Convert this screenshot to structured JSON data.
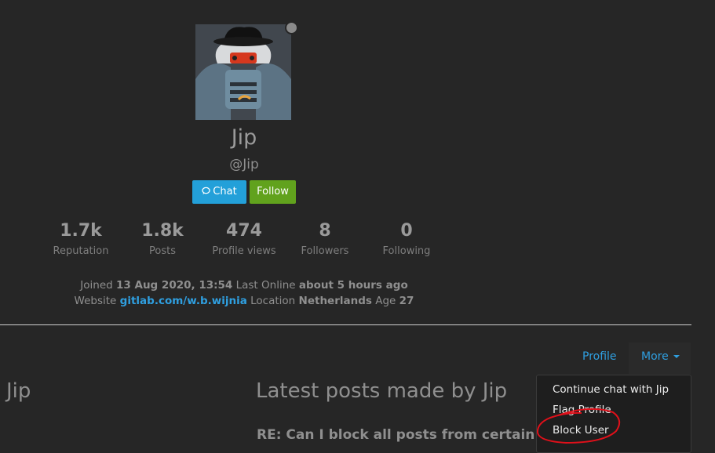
{
  "profile": {
    "name": "Jip",
    "handle": "@Jip",
    "chat_label": "Chat",
    "follow_label": "Follow"
  },
  "stats": [
    {
      "value": "1.7k",
      "label": "Reputation"
    },
    {
      "value": "1.8k",
      "label": "Posts"
    },
    {
      "value": "474",
      "label": "Profile views"
    },
    {
      "value": "8",
      "label": "Followers"
    },
    {
      "value": "0",
      "label": "Following"
    }
  ],
  "info": {
    "joined_label": "Joined",
    "joined_value": "13 Aug 2020, 13:54",
    "last_online_label": "Last Online",
    "last_online_value": "about 5 hours ago",
    "website_label": "Website",
    "website_value": "gitlab.com/w.b.wijnia",
    "location_label": "Location",
    "location_value": "Netherlands",
    "age_label": "Age",
    "age_value": "27"
  },
  "nav": {
    "profile_label": "Profile",
    "more_label": "More"
  },
  "sidebar_title": "Jip",
  "main": {
    "heading": "Latest posts made by Jip",
    "first_post_title": "RE: Can I block all posts from certain users?"
  },
  "dropdown": {
    "items": [
      "Continue chat with Jip",
      "Flag Profile",
      "Block User"
    ]
  },
  "colors": {
    "background": "#262626",
    "link": "#2f9fe0",
    "chat_button": "#23a0d9",
    "follow_button": "#61a21d",
    "annotation": "#e0101a"
  }
}
